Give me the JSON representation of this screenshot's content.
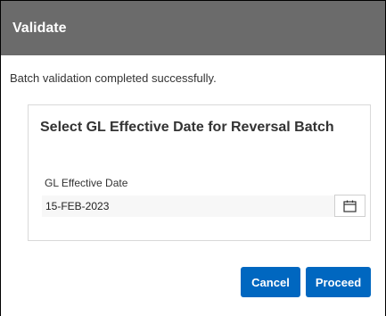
{
  "dialog": {
    "title": "Validate",
    "message": "Batch validation completed successfully."
  },
  "panel": {
    "heading": "Select GL Effective Date for Reversal Batch",
    "date_label": "GL Effective Date",
    "date_value": "15-FEB-2023",
    "calendar_icon": "calendar-icon"
  },
  "actions": {
    "cancel_label": "Cancel",
    "proceed_label": "Proceed"
  },
  "colors": {
    "titlebar": "#6b6b6b",
    "primary_button": "#0067c0"
  }
}
